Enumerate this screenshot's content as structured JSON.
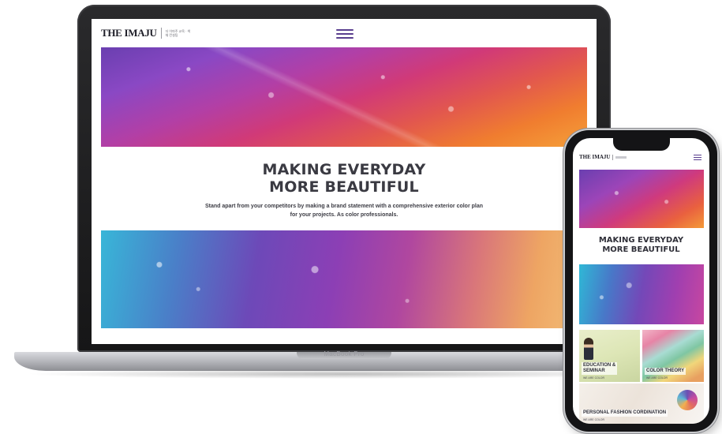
{
  "laptop": {
    "device_label": "MacBook Pro",
    "site": {
      "logo": "THE IMAJU",
      "logo_sub": "더 이마주 교육 · 색채 컨설팅",
      "heading_line1": "MAKING EVERYDAY",
      "heading_line2": "MORE BEAUTIFUL",
      "tagline_line1": "Stand apart from your competitors by making a brand statement with a comprehensive exterior color plan",
      "tagline_line2": "for your projects. As color professionals."
    }
  },
  "phone": {
    "logo": "THE IMAJU",
    "heading_line1": "MAKING EVERYDAY",
    "heading_line2": "MORE BEAUTIFUL",
    "cards": [
      {
        "title_line1": "EDUCATION &",
        "title_line2": "SEMINAR",
        "subtitle": "WE ARE COLOR"
      },
      {
        "title_line1": "COLOR THEORY",
        "title_line2": "",
        "subtitle": "WE ARE COLOR"
      },
      {
        "title_line1": "PERSONAL FASHION CORDINATION",
        "title_line2": "",
        "subtitle": "WE ARE COLOR"
      }
    ]
  },
  "colors": {
    "accent": "#5a3f8f",
    "heading": "#3a3a42"
  },
  "icons": {
    "menu": "hamburger-icon"
  }
}
